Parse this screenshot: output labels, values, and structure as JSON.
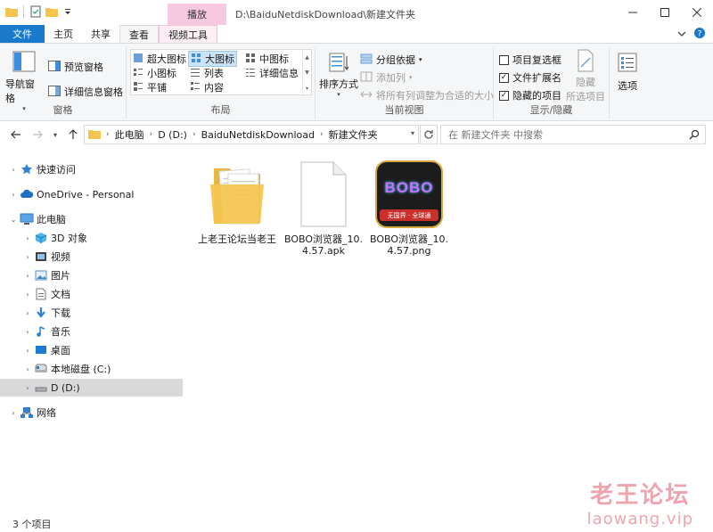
{
  "titlebar": {
    "context_tab_header": "播放",
    "path": "D:\\BaiduNetdiskDownload\\新建文件夹"
  },
  "tabs": [
    "文件",
    "主页",
    "共享",
    "查看",
    "视频工具"
  ],
  "ribbon": {
    "panes": {
      "label": "窗格",
      "nav_pane": "导航窗格",
      "preview_pane": "预览窗格",
      "details_pane": "详细信息窗格"
    },
    "layout": {
      "label": "布局",
      "options": [
        "超大图标",
        "大图标",
        "中图标",
        "小图标",
        "列表",
        "详细信息",
        "平铺",
        "内容"
      ],
      "selected": "大图标"
    },
    "current_view": {
      "label": "当前视图",
      "sort_by": "排序方式",
      "group_by": "分组依据",
      "add_column": "添加列",
      "fit_columns": "将所有列调整为合适的大小"
    },
    "show_hide": {
      "label": "显示/隐藏",
      "item_checkboxes": "项目复选框",
      "file_extensions": "文件扩展名",
      "hidden_items": "隐藏的项目",
      "hide_selected_1": "隐藏",
      "hide_selected_2": "所选项目",
      "item_checkboxes_checked": false,
      "file_extensions_checked": true,
      "hidden_items_checked": true
    },
    "options": "选项"
  },
  "address": {
    "crumbs": [
      "此电脑",
      "D (D:)",
      "BaiduNetdiskDownload",
      "新建文件夹"
    ],
    "search_placeholder": "在 新建文件夹 中搜索"
  },
  "nav": {
    "items": [
      {
        "label": "快速访问",
        "icon": "star-icon"
      },
      {
        "label": "OneDrive - Personal",
        "icon": "cloud-icon"
      },
      {
        "label": "此电脑",
        "icon": "computer-icon"
      },
      {
        "label": "3D 对象",
        "icon": "cube-icon"
      },
      {
        "label": "视频",
        "icon": "video-icon"
      },
      {
        "label": "图片",
        "icon": "picture-icon"
      },
      {
        "label": "文档",
        "icon": "document-icon"
      },
      {
        "label": "下载",
        "icon": "download-icon"
      },
      {
        "label": "音乐",
        "icon": "music-icon"
      },
      {
        "label": "桌面",
        "icon": "desktop-icon"
      },
      {
        "label": "本地磁盘 (C:)",
        "icon": "drive-icon"
      },
      {
        "label": "D (D:)",
        "icon": "drive-icon"
      },
      {
        "label": "网络",
        "icon": "network-icon"
      }
    ],
    "selected": "D (D:)"
  },
  "files": [
    {
      "name": "上老王论坛当老王",
      "type": "folder"
    },
    {
      "name": "BOBO浏览器_10.4.57.apk",
      "type": "apk"
    },
    {
      "name": "BOBO浏览器_10.4.57.png",
      "type": "png",
      "thumb_title": "BOBO",
      "thumb_banner": "无国界 · 全球通"
    }
  ],
  "status": {
    "item_count": "3 个项目"
  },
  "watermark": {
    "line1": "老王论坛",
    "line2": "laowang.vip"
  },
  "colors": {
    "file_tab": "#1979ca",
    "context_tab": "#f7c9e0",
    "selection": "#cce4f7",
    "folder": "#f5c44f"
  }
}
